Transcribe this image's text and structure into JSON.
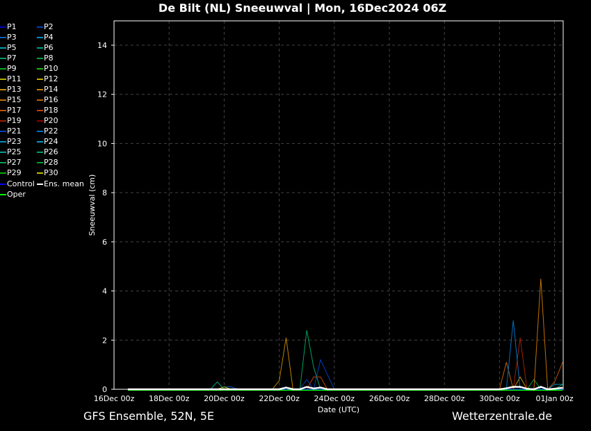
{
  "title": "De Bilt  (NL)  Sneeuwval | Mon, 16Dec2024 06Z",
  "footer_left": "GFS Ensemble, 52N, 5E",
  "footer_right": "Wetterzentrale.de",
  "chart_data": {
    "type": "line",
    "ylabel": "Sneeuwval (cm)",
    "xlabel": "Date (UTC)",
    "ylim": [
      0,
      15
    ],
    "yticks": [
      0,
      2,
      4,
      6,
      8,
      10,
      12,
      14
    ],
    "xlim_hours": [
      0,
      391
    ],
    "xticks": [
      {
        "h": 0,
        "label": "16Dec 00z"
      },
      {
        "h": 48,
        "label": "18Dec 00z"
      },
      {
        "h": 96,
        "label": "20Dec 00z"
      },
      {
        "h": 144,
        "label": "22Dec 00z"
      },
      {
        "h": 192,
        "label": "24Dec 00z"
      },
      {
        "h": 240,
        "label": "26Dec 00z"
      },
      {
        "h": 288,
        "label": "28Dec 00z"
      },
      {
        "h": 336,
        "label": "30Dec 00z"
      },
      {
        "h": 384,
        "label": "01Jan 00z"
      }
    ],
    "grid": true,
    "series": [
      {
        "name": "P1",
        "color": "#0000c8",
        "points": []
      },
      {
        "name": "P2",
        "color": "#0040c0",
        "points": [
          [
            174,
            0
          ],
          [
            180,
            1.2
          ],
          [
            192,
            0
          ]
        ]
      },
      {
        "name": "P3",
        "color": "#0060c0",
        "points": [
          [
            90,
            0
          ],
          [
            96,
            0.1
          ],
          [
            102,
            0.1
          ],
          [
            108,
            0
          ]
        ]
      },
      {
        "name": "P4",
        "color": "#0090c0",
        "points": []
      },
      {
        "name": "P5",
        "color": "#00a0b0",
        "points": []
      },
      {
        "name": "P6",
        "color": "#00a080",
        "points": [
          [
            84,
            0
          ],
          [
            90,
            0.3
          ],
          [
            96,
            0
          ]
        ]
      },
      {
        "name": "P7",
        "color": "#00a060",
        "points": [
          [
            162,
            0
          ],
          [
            168,
            2.4
          ],
          [
            174,
            0.9
          ],
          [
            180,
            0
          ]
        ]
      },
      {
        "name": "P8",
        "color": "#00a040",
        "points": [
          [
            360,
            0
          ],
          [
            366,
            0.4
          ],
          [
            372,
            0
          ]
        ]
      },
      {
        "name": "P9",
        "color": "#00b020",
        "points": []
      },
      {
        "name": "P10",
        "color": "#10c010",
        "points": []
      },
      {
        "name": "P11",
        "color": "#b0b000",
        "points": [
          [
            90,
            0
          ],
          [
            96,
            0.1
          ],
          [
            102,
            0
          ]
        ]
      },
      {
        "name": "P12",
        "color": "#c0b000",
        "points": []
      },
      {
        "name": "P13",
        "color": "#c09000",
        "points": [
          [
            342,
            0
          ],
          [
            348,
            0
          ],
          [
            354,
            0.5
          ],
          [
            360,
            0
          ]
        ]
      },
      {
        "name": "P14",
        "color": "#c08000",
        "points": [
          [
            138,
            0
          ],
          [
            144,
            0.35
          ],
          [
            150,
            2.1
          ],
          [
            156,
            0
          ]
        ]
      },
      {
        "name": "P15",
        "color": "#c07000",
        "points": [
          [
            366,
            0
          ],
          [
            372,
            4.5
          ],
          [
            378,
            0
          ]
        ]
      },
      {
        "name": "P16",
        "color": "#c06000",
        "points": [
          [
            330,
            0
          ],
          [
            336,
            0
          ],
          [
            342,
            1.1
          ],
          [
            348,
            0
          ]
        ]
      },
      {
        "name": "P17",
        "color": "#c05000",
        "points": [
          [
            378,
            0
          ],
          [
            384,
            0.3
          ],
          [
            391,
            1.1
          ]
        ]
      },
      {
        "name": "P18",
        "color": "#c04010",
        "points": [
          [
            168,
            0
          ],
          [
            174,
            0.5
          ],
          [
            180,
            0.5
          ],
          [
            186,
            0
          ]
        ]
      },
      {
        "name": "P19",
        "color": "#a02000",
        "points": [
          [
            348,
            0
          ],
          [
            354,
            2.1
          ],
          [
            360,
            0
          ]
        ]
      },
      {
        "name": "P20",
        "color": "#900000",
        "points": []
      },
      {
        "name": "P21",
        "color": "#0040c0",
        "points": [
          [
            162,
            0
          ],
          [
            168,
            0.4
          ],
          [
            174,
            0
          ]
        ]
      },
      {
        "name": "P22",
        "color": "#0070c0",
        "points": [
          [
            342,
            0
          ],
          [
            348,
            2.8
          ],
          [
            354,
            0
          ]
        ]
      },
      {
        "name": "P23",
        "color": "#0090c0",
        "points": [
          [
            378,
            0
          ],
          [
            384,
            0.2
          ],
          [
            391,
            0.2
          ]
        ]
      },
      {
        "name": "P24",
        "color": "#00a0c0",
        "points": []
      },
      {
        "name": "P25",
        "color": "#00a090",
        "points": []
      },
      {
        "name": "P26",
        "color": "#00a070",
        "points": [
          [
            384,
            0
          ],
          [
            391,
            0.2
          ]
        ]
      },
      {
        "name": "P27",
        "color": "#00a050",
        "points": []
      },
      {
        "name": "P28",
        "color": "#00a030",
        "points": []
      },
      {
        "name": "P29",
        "color": "#00b000",
        "points": []
      },
      {
        "name": "P30",
        "color": "#c0c000",
        "points": []
      },
      {
        "name": "Control",
        "color": "#0000ff",
        "points": []
      },
      {
        "name": "Ens. mean",
        "color": "#ffffff",
        "points": [
          [
            144,
            0
          ],
          [
            150,
            0.07
          ],
          [
            156,
            0
          ],
          [
            162,
            0
          ],
          [
            168,
            0.1
          ],
          [
            174,
            0.03
          ],
          [
            180,
            0.07
          ],
          [
            186,
            0
          ],
          [
            336,
            0
          ],
          [
            342,
            0.04
          ],
          [
            348,
            0.1
          ],
          [
            354,
            0.1
          ],
          [
            360,
            0.02
          ],
          [
            366,
            0
          ],
          [
            372,
            0.1
          ],
          [
            378,
            0
          ],
          [
            384,
            0.02
          ],
          [
            391,
            0.06
          ]
        ]
      },
      {
        "name": "Oper",
        "color": "#00ff00",
        "points": []
      }
    ]
  }
}
